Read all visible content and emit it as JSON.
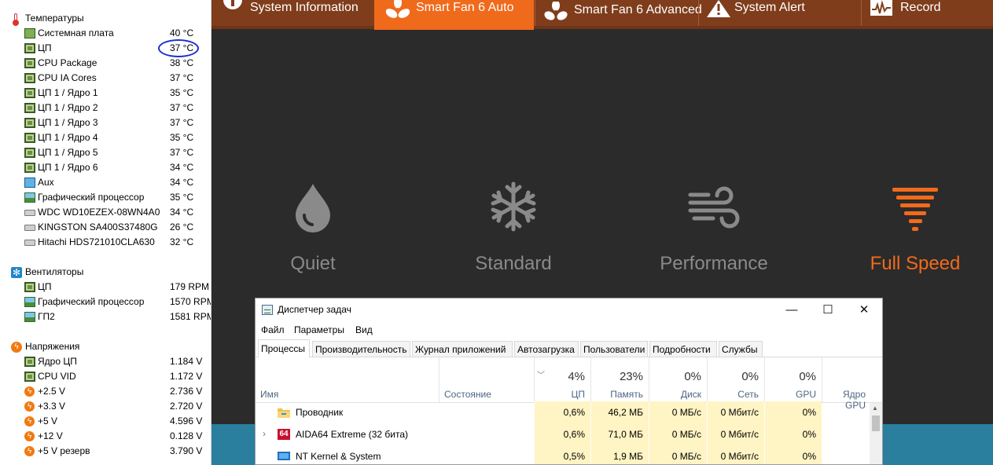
{
  "sensors": {
    "sections": [
      {
        "title": "Температуры",
        "icon": "thermometer-icon",
        "rows": [
          {
            "icon": "motherboard-icon",
            "label": "Системная плата",
            "value": "40 °C"
          },
          {
            "icon": "cpu-chip-icon",
            "label": "ЦП",
            "value": "37 °C"
          },
          {
            "icon": "cpu-chip-icon",
            "label": "CPU Package",
            "value": "38 °C"
          },
          {
            "icon": "cpu-chip-icon",
            "label": "CPU IA Cores",
            "value": "37 °C"
          },
          {
            "icon": "cpu-chip-icon",
            "label": "ЦП 1 / Ядро 1",
            "value": "35 °C"
          },
          {
            "icon": "cpu-chip-icon",
            "label": "ЦП 1 / Ядро 2",
            "value": "37 °C"
          },
          {
            "icon": "cpu-chip-icon",
            "label": "ЦП 1 / Ядро 3",
            "value": "37 °C"
          },
          {
            "icon": "cpu-chip-icon",
            "label": "ЦП 1 / Ядро 4",
            "value": "35 °C"
          },
          {
            "icon": "cpu-chip-icon",
            "label": "ЦП 1 / Ядро 5",
            "value": "37 °C"
          },
          {
            "icon": "cpu-chip-icon",
            "label": "ЦП 1 / Ядро 6",
            "value": "34 °C"
          },
          {
            "icon": "monitor-icon",
            "label": "Aux",
            "value": "34 °C"
          },
          {
            "icon": "gpu-icon",
            "label": "Графический процессор",
            "value": "35 °C"
          },
          {
            "icon": "disk-icon",
            "label": "WDC WD10EZEX-08WN4A0",
            "value": "34 °C"
          },
          {
            "icon": "disk-icon",
            "label": "KINGSTON SA400S37480G",
            "value": "26 °C"
          },
          {
            "icon": "disk-icon",
            "label": "Hitachi HDS721010CLA630",
            "value": "32 °C"
          }
        ]
      },
      {
        "title": "Вентиляторы",
        "icon": "fan-icon",
        "rows": [
          {
            "icon": "cpu-chip-icon",
            "label": "ЦП",
            "value": "179 RPM"
          },
          {
            "icon": "gpu-icon",
            "label": "Графический процессор",
            "value": "1570 RPM"
          },
          {
            "icon": "gpu-icon",
            "label": "ГП2",
            "value": "1581 RPM"
          }
        ]
      },
      {
        "title": "Напряжения",
        "icon": "voltage-icon",
        "rows": [
          {
            "icon": "cpu-chip-icon",
            "label": "Ядро ЦП",
            "value": "1.184 V"
          },
          {
            "icon": "cpu-chip-icon",
            "label": "CPU VID",
            "value": "1.172 V"
          },
          {
            "icon": "voltage-icon",
            "label": "+2.5 V",
            "value": "2.736 V"
          },
          {
            "icon": "voltage-icon",
            "label": "+3.3 V",
            "value": "2.720 V"
          },
          {
            "icon": "voltage-icon",
            "label": "+5 V",
            "value": "4.596 V"
          },
          {
            "icon": "voltage-icon",
            "label": "+12 V",
            "value": "0.128 V"
          },
          {
            "icon": "voltage-icon",
            "label": "+5 V резерв",
            "value": "3.790 V"
          }
        ]
      }
    ]
  },
  "fan_app": {
    "tabs": [
      {
        "icon": "info-icon",
        "label": "System Information",
        "active": false
      },
      {
        "icon": "fan-icon",
        "label": "Smart Fan 6 Auto",
        "active": true
      },
      {
        "icon": "fan-icon",
        "label": "Smart Fan 6 Advanced",
        "active": false
      },
      {
        "icon": "alert-icon",
        "label": "System Alert",
        "active": false
      },
      {
        "icon": "record-icon",
        "label": "Record",
        "active": false
      }
    ],
    "modes": [
      {
        "icon": "drop-icon",
        "label": "Quiet",
        "active": false
      },
      {
        "icon": "snowflake-icon",
        "label": "Standard",
        "active": false
      },
      {
        "icon": "wind-icon",
        "label": "Performance",
        "active": false
      },
      {
        "icon": "tornado-icon",
        "label": "Full Speed",
        "active": true
      }
    ],
    "colors": {
      "accent": "#f06a1c",
      "tab_bar": "#7f3d1c",
      "inactive_mode": "#8a8a8a"
    }
  },
  "task_manager": {
    "title": "Диспетчер задач",
    "window_buttons": {
      "minimize": "—",
      "maximize": "☐",
      "close": "✕"
    },
    "menu": [
      "Файл",
      "Параметры",
      "Вид"
    ],
    "tabs": [
      "Процессы",
      "Производительность",
      "Журнал приложений",
      "Автозагрузка",
      "Пользователи",
      "Подробности",
      "Службы"
    ],
    "active_tab": "Процессы",
    "columns": {
      "name": "Имя",
      "state": "Состояние",
      "cpu": {
        "pct": "4%",
        "label": "ЦП"
      },
      "memory": {
        "pct": "23%",
        "label": "Память"
      },
      "disk": {
        "pct": "0%",
        "label": "Диск"
      },
      "network": {
        "pct": "0%",
        "label": "Сеть"
      },
      "gpu": {
        "pct": "0%",
        "label": "GPU"
      },
      "gpu_engine": {
        "label": "Ядро GPU"
      }
    },
    "processes": [
      {
        "name": "Проводник",
        "icon": "folder-icon",
        "expandable": false,
        "cpu": "0,6%",
        "memory": "46,2 МБ",
        "disk": "0 МБ/с",
        "network": "0 Мбит/с",
        "gpu": "0%"
      },
      {
        "name": "AIDA64 Extreme (32 бита)",
        "icon": "aida64-icon",
        "icon_text": "64",
        "expandable": true,
        "cpu": "0,6%",
        "memory": "71,0 МБ",
        "disk": "0 МБ/с",
        "network": "0 Мбит/с",
        "gpu": "0%"
      },
      {
        "name": "NT Kernel & System",
        "icon": "system-icon",
        "expandable": false,
        "cpu": "0,5%",
        "memory": "1,9 МБ",
        "disk": "0 МБ/с",
        "network": "0 Мбит/с",
        "gpu": "0%"
      }
    ]
  }
}
